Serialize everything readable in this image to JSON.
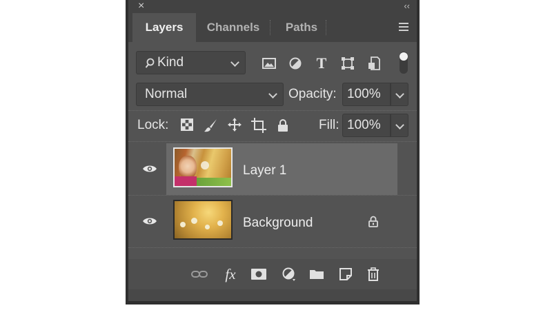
{
  "window": {
    "close_glyph": "×",
    "collapse_glyph": "‹‹"
  },
  "tabs": [
    {
      "label": "Layers",
      "active": true
    },
    {
      "label": "Channels",
      "active": false
    },
    {
      "label": "Paths",
      "active": false
    }
  ],
  "filter": {
    "kind_label": "Kind",
    "icons": [
      "image-filter-icon",
      "adjustment-filter-icon",
      "type-filter-icon",
      "shape-filter-icon",
      "smart-object-filter-icon"
    ],
    "type_glyph": "T",
    "toggle_on": true
  },
  "blend": {
    "mode": "Normal",
    "opacity_label": "Opacity:",
    "opacity_value": "100%"
  },
  "lock": {
    "label": "Lock:",
    "icons": [
      "lock-transparent-pixels-icon",
      "lock-image-pixels-icon",
      "lock-position-icon",
      "lock-artboard-icon",
      "lock-all-icon"
    ],
    "fill_label": "Fill:",
    "fill_value": "100%"
  },
  "layers": [
    {
      "name": "Layer 1",
      "visible": true,
      "selected": true,
      "locked": false
    },
    {
      "name": "Background",
      "visible": true,
      "selected": false,
      "locked": true
    }
  ],
  "footer": {
    "icons": [
      "link-layers-icon",
      "fx-icon",
      "add-mask-icon",
      "new-adjustment-icon",
      "new-group-icon",
      "new-layer-icon",
      "delete-icon"
    ],
    "fx_label": "fx"
  },
  "colors": {
    "panel": "#535353",
    "tab_bar": "#424242",
    "selected_row": "#6a6a6a"
  }
}
